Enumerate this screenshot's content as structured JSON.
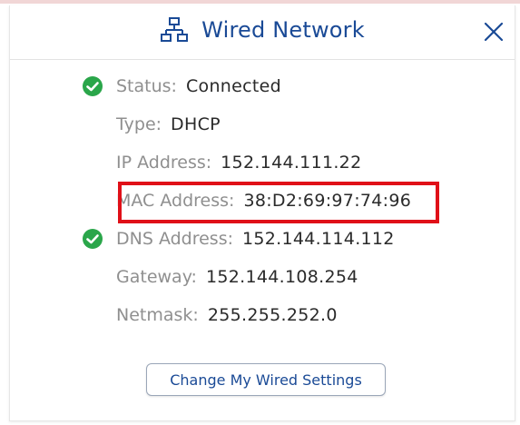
{
  "dialog": {
    "title": "Wired Network",
    "title_icon": "network-icon",
    "close_icon": "close-icon",
    "accent_color": "#1a4a96"
  },
  "details": [
    {
      "label": "Status:",
      "value": "Connected",
      "check": true
    },
    {
      "label": "Type:",
      "value": "DHCP",
      "check": false
    },
    {
      "label": "IP Address:",
      "value": "152.144.111.22",
      "check": false
    },
    {
      "label": "MAC Address:",
      "value": "38:D2:69:97:74:96",
      "check": false,
      "highlighted": true
    },
    {
      "label": "DNS Address:",
      "value": "152.144.114.112",
      "check": true
    },
    {
      "label": "Gateway:",
      "value": "152.144.108.254",
      "check": false
    },
    {
      "label": "Netmask:",
      "value": "255.255.252.0",
      "check": false
    }
  ],
  "status_icon": {
    "name": "check-circle-icon",
    "color": "#2aa64a"
  },
  "highlight_color": "#e01018",
  "actions": {
    "settings_label": "Change My Wired Settings"
  }
}
